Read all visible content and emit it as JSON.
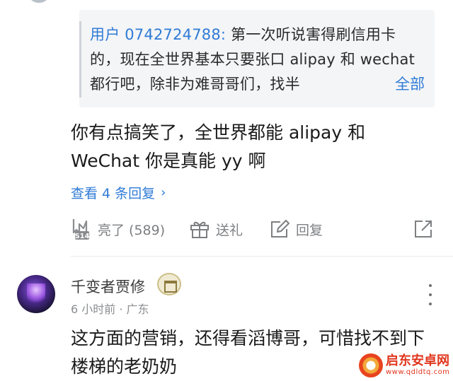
{
  "quoted": {
    "user": "用户 0742724788:",
    "text": " 第一次听说害得刷信用卡的，现在全世界基本只要张口 alipay 和 wechat 都行吧，除非为难哥哥们，找半",
    "more_label": "全部"
  },
  "reply": {
    "body": "你有点搞笑了，全世界都能 alipay 和 WeChat 你是真能 yy 啊",
    "view_replies": "查看 4 条回复",
    "actions": {
      "like_label": "亮了 (589)",
      "gift_label": "送礼",
      "reply_label": "回复"
    }
  },
  "comment": {
    "username": "千变者贾修",
    "time_location": "6 小时前 · 广东",
    "body": "这方面的营销，还得看滔博哥，可惜找不到下楼梯的老奶奶"
  },
  "watermark": {
    "title": "启东安卓网",
    "url": "www.qdldtq.com"
  },
  "icons": {
    "like": "like-badge-icon",
    "gift": "gift-icon",
    "reply": "edit-reply-icon",
    "share": "share-icon",
    "more": "more-vertical-icon"
  },
  "colors": {
    "link_blue": "#2f7bd6",
    "muted_gray": "#7d7f82",
    "quote_bg": "#f4f5f7",
    "watermark_red": "#e0361d"
  }
}
